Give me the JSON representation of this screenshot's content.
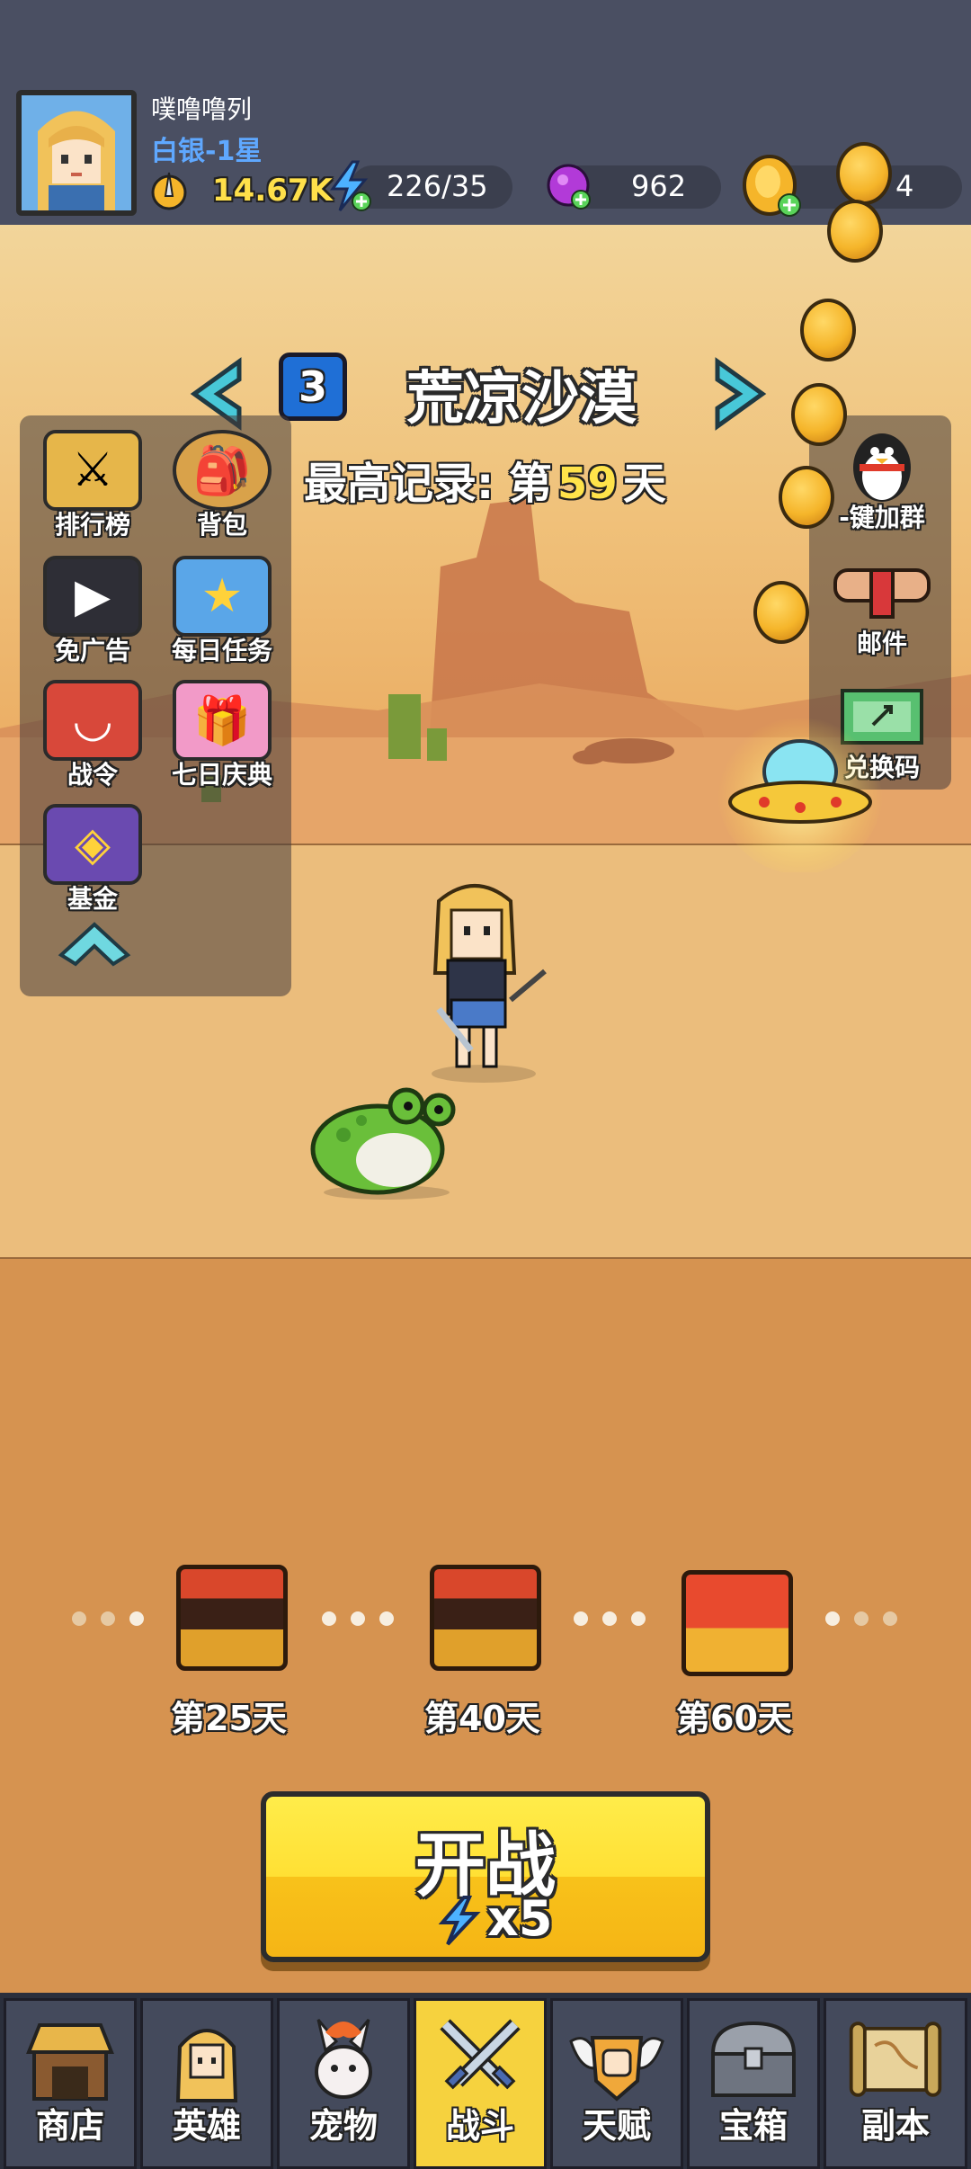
{
  "player": {
    "name": "噗噜噜列",
    "rank": "白银-1星",
    "power": "14.67K"
  },
  "resources": {
    "energy": "226/35",
    "gems": "962",
    "gold": "4"
  },
  "stage": {
    "number": "3",
    "name": "荒凉沙漠",
    "record_prefix": "最高记录: 第",
    "record_value": "59",
    "record_suffix": "天"
  },
  "left_menu": [
    {
      "label": "排行榜",
      "icon": "leaderboard-icon"
    },
    {
      "label": "背包",
      "icon": "backpack-icon"
    },
    {
      "label": "免广告",
      "icon": "no-ads-icon"
    },
    {
      "label": "每日任务",
      "icon": "daily-task-icon"
    },
    {
      "label": "战令",
      "icon": "battle-pass-icon"
    },
    {
      "label": "七日庆典",
      "icon": "seven-day-gift-icon"
    },
    {
      "label": "基金",
      "icon": "fund-safe-icon"
    }
  ],
  "right_menu": [
    {
      "label": "-键加群",
      "icon": "qq-penguin-icon"
    },
    {
      "label": "邮件",
      "icon": "mail-icon"
    },
    {
      "label": "兑换码",
      "icon": "redeem-code-icon"
    }
  ],
  "rewards": [
    {
      "label": "第25天",
      "state": "opened"
    },
    {
      "label": "第40天",
      "state": "opened"
    },
    {
      "label": "第60天",
      "state": "closed"
    }
  ],
  "start_button": {
    "label": "开战",
    "cost": "x5"
  },
  "nav": [
    {
      "label": "商店",
      "icon": "shop-icon",
      "active": false
    },
    {
      "label": "英雄",
      "icon": "hero-icon",
      "active": false
    },
    {
      "label": "宠物",
      "icon": "pet-icon",
      "active": false
    },
    {
      "label": "战斗",
      "icon": "battle-swords-icon",
      "active": true
    },
    {
      "label": "天赋",
      "icon": "talent-icon",
      "active": false
    },
    {
      "label": "宝箱",
      "icon": "treasure-chest-icon",
      "active": false
    },
    {
      "label": "副本",
      "icon": "dungeon-map-icon",
      "active": false
    }
  ],
  "colors": {
    "top_bar": "#4a4f62",
    "rank_blue": "#5fa8ff",
    "power_yellow": "#ffe04a",
    "start_button": "#ffe034",
    "active_tab": "#f6d23e"
  }
}
